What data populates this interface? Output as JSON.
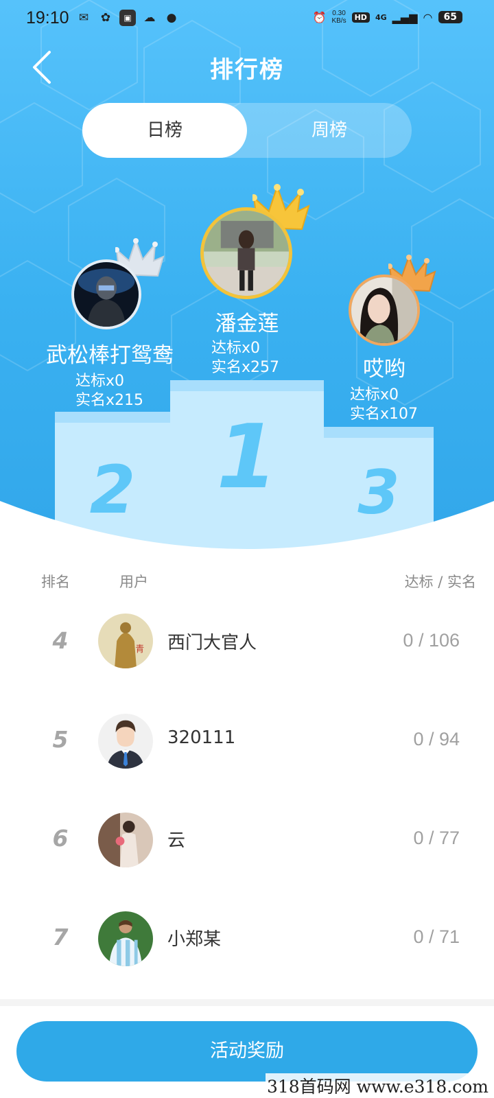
{
  "status_bar": {
    "time": "19:10",
    "speed_value": "0.30",
    "speed_unit": "KB/s",
    "hd": "HD",
    "network": "4G",
    "battery": "65"
  },
  "header": {
    "title": "排行榜"
  },
  "tabs": {
    "daily": "日榜",
    "weekly": "周榜",
    "active": "日榜"
  },
  "podium": {
    "first": {
      "rank": "1",
      "name": "潘金莲",
      "target": "达标x0",
      "verified": "实名x257"
    },
    "second": {
      "rank": "2",
      "name": "武松棒打鸳鸯",
      "target": "达标x0",
      "verified": "实名x215"
    },
    "third": {
      "rank": "3",
      "name": "哎哟",
      "target": "达标x0",
      "verified": "实名x107"
    }
  },
  "list": {
    "headers": {
      "rank": "排名",
      "user": "用户",
      "score": "达标 / 实名"
    },
    "rows": [
      {
        "rank": "4",
        "name": "西门大官人",
        "score": "0 / 106"
      },
      {
        "rank": "5",
        "name": "320111",
        "score": "0 / 94"
      },
      {
        "rank": "6",
        "name": "云",
        "score": "0 / 77"
      },
      {
        "rank": "7",
        "name": "小郑某",
        "score": "0 / 71"
      }
    ]
  },
  "footer": {
    "button": "活动奖励"
  },
  "watermark": "318首码网  www.e318.com",
  "colors": {
    "brand_blue": "#2fa9e8",
    "gold_crown": "#f7c53a",
    "silver_crown": "#dfe6ee",
    "bronze_crown": "#f2a44a"
  }
}
